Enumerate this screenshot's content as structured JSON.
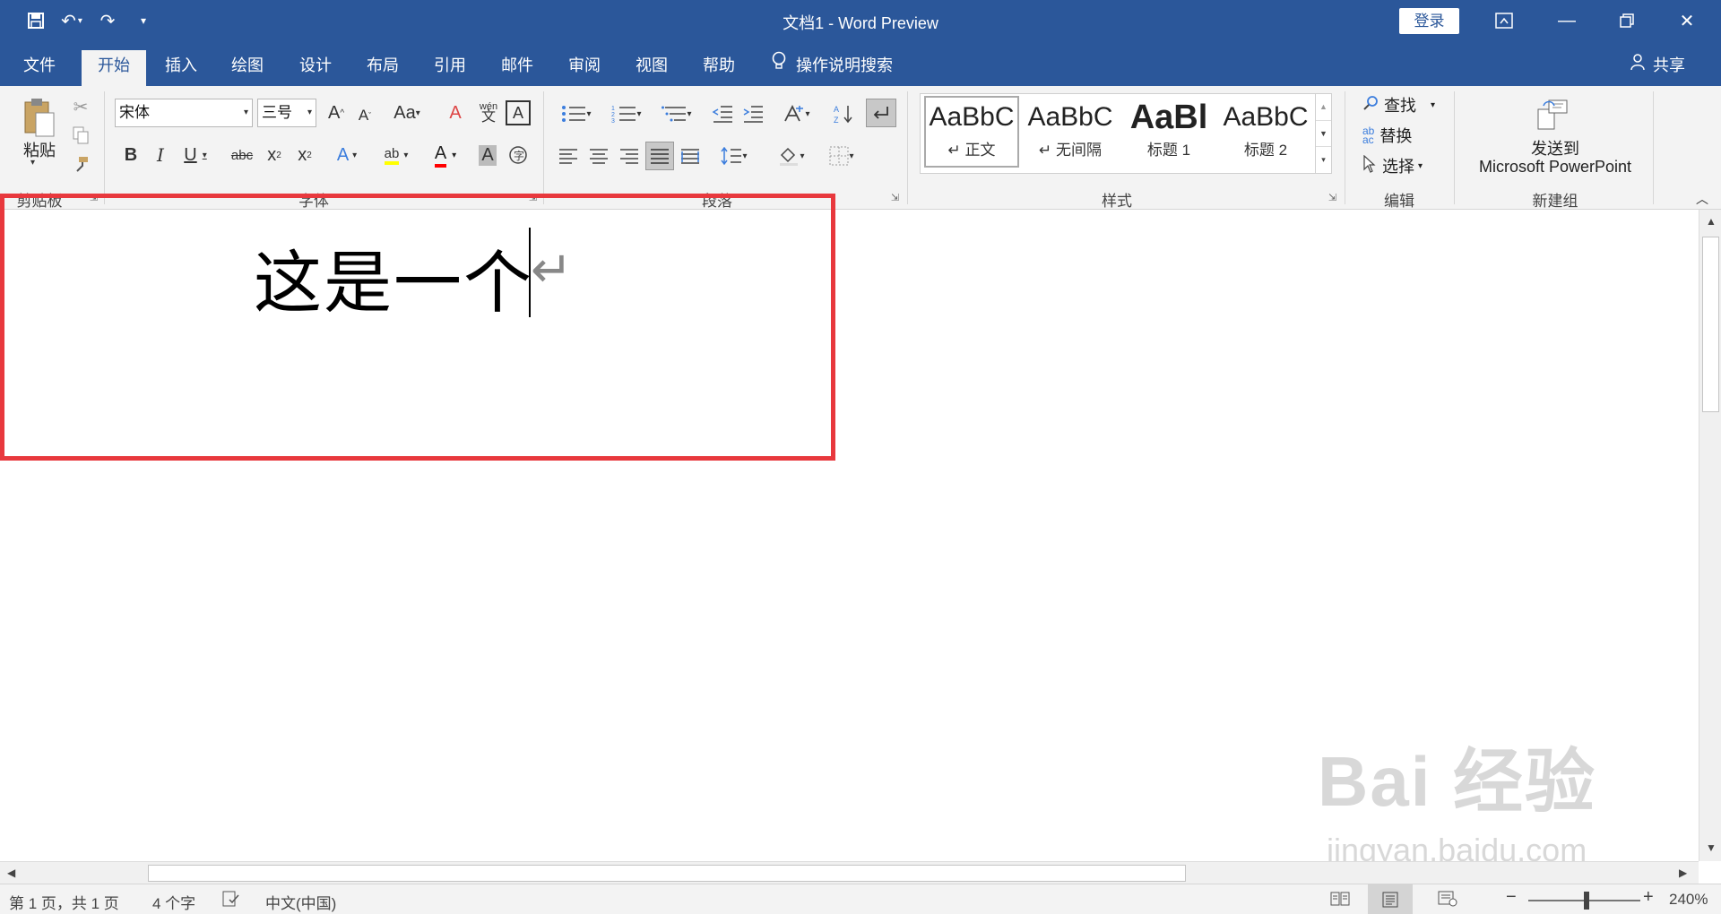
{
  "titlebar": {
    "doc_title": "文档1  -  Word Preview",
    "login": "登录",
    "bg_color": "#2b579a"
  },
  "tabs": [
    "文件",
    "开始",
    "插入",
    "绘图",
    "设计",
    "布局",
    "引用",
    "邮件",
    "审阅",
    "视图",
    "帮助"
  ],
  "active_tab": "开始",
  "search_label": "操作说明搜索",
  "share_label": "共享",
  "ribbon": {
    "clipboard": {
      "paste": "粘贴",
      "label": "剪贴板"
    },
    "font": {
      "name": "宋体",
      "size": "三号",
      "label": "字体",
      "phonetic": "wén"
    },
    "paragraph": {
      "label": "段落"
    },
    "styles": {
      "label": "样式",
      "items": [
        {
          "sample": "AaBbC",
          "name": "↵ 正文"
        },
        {
          "sample": "AaBbC",
          "name": "↵ 无间隔"
        },
        {
          "sample": "AaBl",
          "name": "标题 1"
        },
        {
          "sample": "AaBbC",
          "name": "标题 2"
        }
      ]
    },
    "editing": {
      "label": "编辑",
      "find": "查找",
      "replace": "替换",
      "select": "选择"
    },
    "newgroup": {
      "label": "新建组",
      "send_line1": "发送到",
      "send_line2": "Microsoft PowerPoint"
    }
  },
  "document": {
    "text": "这是一个",
    "paragraph_mark": "↵"
  },
  "watermark": {
    "big": "Bai 经验",
    "small": "jingyan.baidu.com"
  },
  "status": {
    "page": "第 1 页，共 1 页",
    "words": "4 个字",
    "language": "中文(中国)",
    "zoom": "240%",
    "zoom_minus": "−",
    "zoom_plus": "+"
  },
  "colors": {
    "accent": "#2b579a",
    "highlight_box": "#e8383d"
  }
}
